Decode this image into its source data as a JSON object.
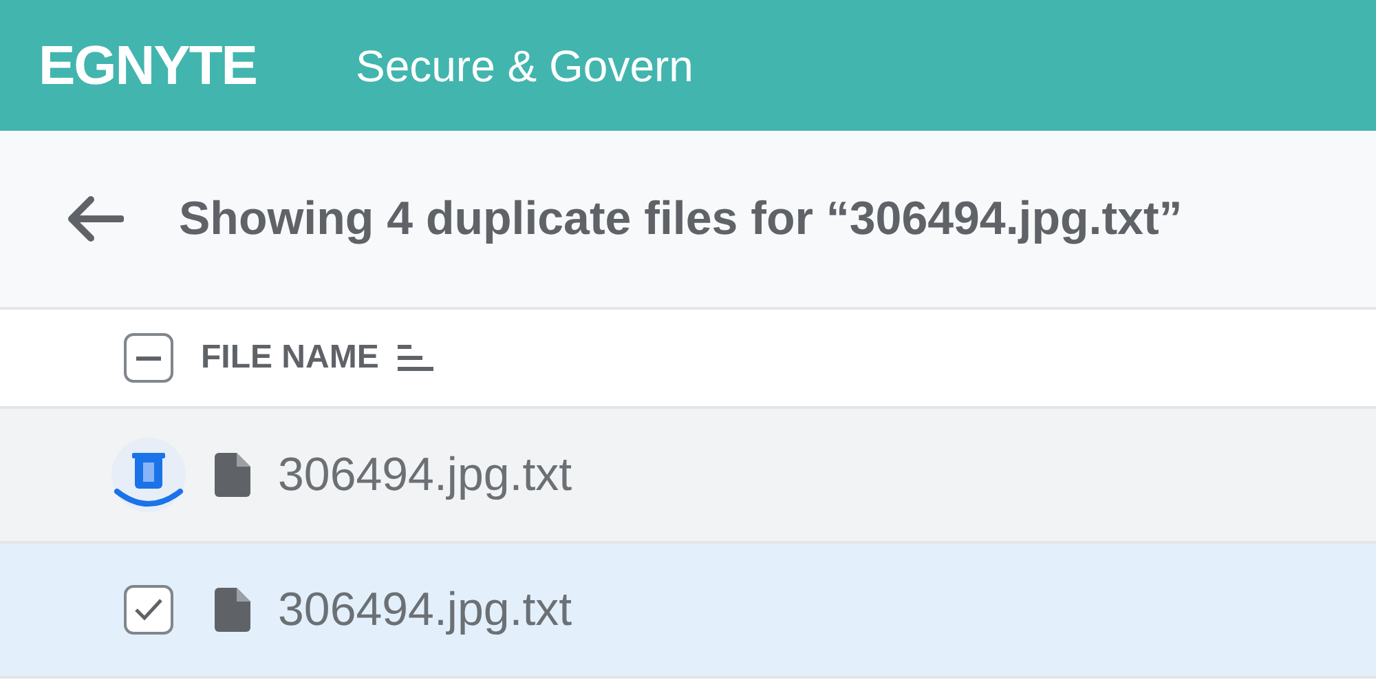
{
  "header": {
    "logo": "EGNYTE",
    "product": "Secure & Govern"
  },
  "title": "Showing 4 duplicate files for “306494.jpg.txt”",
  "table": {
    "select_all": {
      "indeterminate": true
    },
    "columns": [
      {
        "label": "FILE NAME"
      }
    ],
    "rows": [
      {
        "kind": "trash",
        "name": "306494.jpg.txt",
        "selected": false
      },
      {
        "kind": "checkbox",
        "name": "306494.jpg.txt",
        "checked": true,
        "selected": true
      }
    ]
  }
}
